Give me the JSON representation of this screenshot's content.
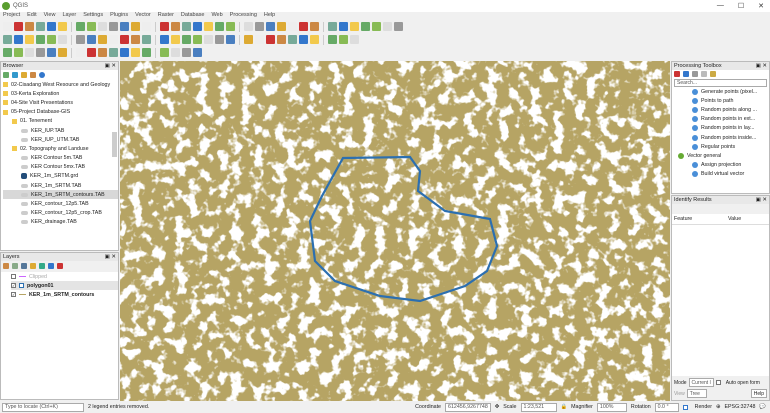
{
  "window": {
    "title": "QGIS",
    "controls": [
      "—",
      "☐",
      "✕"
    ]
  },
  "menu": [
    "Project",
    "Edit",
    "View",
    "Layer",
    "Settings",
    "Plugins",
    "Vector",
    "Raster",
    "Database",
    "Web",
    "Processing",
    "Help"
  ],
  "colors": {
    "map_fill": "#b6a464",
    "polygon_stroke": "#2c6fb0",
    "accent": "#4a8fd8"
  },
  "browser": {
    "title": "Browser",
    "items": [
      {
        "label": "02-Cisadang West Resource and Geology",
        "type": "folder",
        "indent": 0
      },
      {
        "label": "03-Kerta Exploration",
        "type": "folder",
        "indent": 0
      },
      {
        "label": "04-Site Visit Presentations",
        "type": "folder",
        "indent": 0
      },
      {
        "label": "05-Project Database-GIS",
        "type": "folder",
        "indent": 0
      },
      {
        "label": "01. Tenement",
        "type": "folder",
        "indent": 1
      },
      {
        "label": "KER_IUP.TAB",
        "type": "layer",
        "indent": 2
      },
      {
        "label": "KER_IUP_UTM.TAB",
        "type": "layer",
        "indent": 2
      },
      {
        "label": "02. Topography and Landuse",
        "type": "folder",
        "indent": 1
      },
      {
        "label": "KER Contour 5m.TAB",
        "type": "layer",
        "indent": 2
      },
      {
        "label": "KER Contour 5mx.TAB",
        "type": "layer",
        "indent": 2
      },
      {
        "label": "KER_1m_SRTM.grd",
        "type": "raster",
        "indent": 2
      },
      {
        "label": "KER_1m_SRTM.TAB",
        "type": "layer",
        "indent": 2
      },
      {
        "label": "KER_1m_SRTM_contours.TAB",
        "type": "layer",
        "indent": 2,
        "selected": true
      },
      {
        "label": "KER_contour_12p5.TAB",
        "type": "layer",
        "indent": 2
      },
      {
        "label": "KER_contour_12p5_crop.TAB",
        "type": "layer",
        "indent": 2
      },
      {
        "label": "KER_drainage.TAB",
        "type": "layer",
        "indent": 2
      }
    ]
  },
  "layers": {
    "title": "Layers",
    "items": [
      {
        "label": "Clipped",
        "checked": false,
        "dim": true
      },
      {
        "label": "polygon01",
        "checked": true,
        "bold": true
      },
      {
        "label": "KER_1m_SRTM_contours",
        "checked": true,
        "bold": true
      }
    ]
  },
  "processing": {
    "title": "Processing Toolbox",
    "search_placeholder": "Search...",
    "items": [
      {
        "label": "Generate points (pixel...",
        "indent": 2
      },
      {
        "label": "Points to path",
        "indent": 2
      },
      {
        "label": "Random points along ...",
        "indent": 2
      },
      {
        "label": "Random points in ext...",
        "indent": 2
      },
      {
        "label": "Random points in lay...",
        "indent": 2
      },
      {
        "label": "Random points inside...",
        "indent": 2
      },
      {
        "label": "Regular points",
        "indent": 2
      },
      {
        "label": "Vector general",
        "indent": 1
      },
      {
        "label": "Assign projection",
        "indent": 2
      },
      {
        "label": "Build virtual vector",
        "indent": 2
      }
    ]
  },
  "identify": {
    "title": "Identify Results",
    "col_feature": "Feature",
    "col_value": "Value",
    "mode_label": "Mode",
    "mode_value": "Current l",
    "auto_open": "Auto open form",
    "view_label": "View",
    "view_value": "Tree",
    "help": "Help"
  },
  "status": {
    "locate_placeholder": "Type to locate (Ctrl+K)",
    "message": "2 legend entries removed.",
    "coordinate_label": "Coordinate",
    "coordinate": "612456,9267748",
    "scale_label": "Scale",
    "scale": "1:23,521",
    "magnifier_label": "Magnifier",
    "magnifier": "100%",
    "rotation_label": "Rotation",
    "rotation": "0.0 °",
    "render": "Render",
    "crs": "EPSG:32748"
  }
}
